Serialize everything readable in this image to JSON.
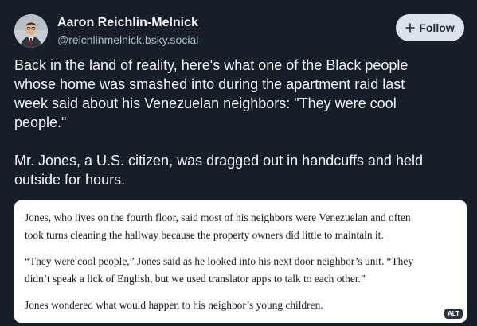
{
  "author": {
    "display_name": "Aaron Reichlin-Melnick",
    "handle": "@reichlinmelnick.bsky.social"
  },
  "follow_button": {
    "label": "Follow",
    "icon": "plus-icon"
  },
  "post": {
    "paragraphs": [
      "Back in the land of reality, here's what one of the Black people\nwhose home was smashed into during the apartment raid last\nweek said about his Venezuelan neighbors: \"They were cool\npeople.\"",
      "Mr. Jones, a U.S. citizen, was dragged out in handcuffs and held\noutside for hours."
    ]
  },
  "image": {
    "quote_paragraphs": [
      "Jones, who lives on the fourth floor, said most of his neighbors were Venezuelan and often\ntook turns cleaning the hallway because the property owners did little to maintain it.",
      "“They were cool people,” Jones said as he looked into his next door neighbor’s unit. “They\ndidn’t speak a lick of English, but we used translator apps to talk to each other.”",
      "Jones wondered what would happen to his neighbor’s young children."
    ],
    "alt_badge": "ALT"
  },
  "colors": {
    "background": "#161e27",
    "text": "#f1f3f5",
    "muted": "#aebbc9",
    "follow_bg": "#dde3ea"
  }
}
